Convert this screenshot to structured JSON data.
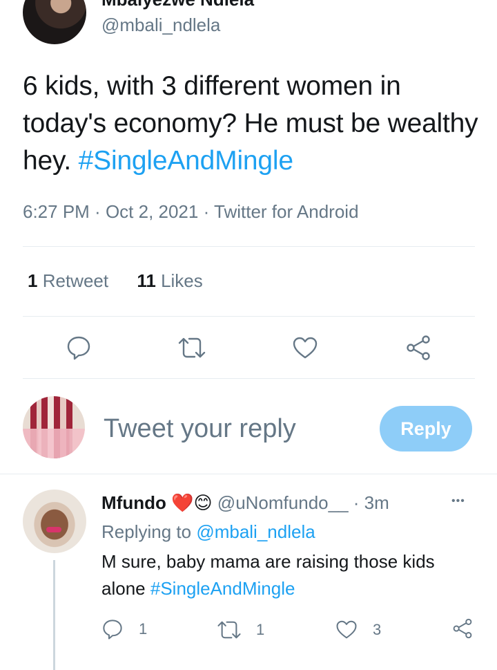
{
  "tweet": {
    "author_name": "Mbalyezwe Ndlela",
    "handle": "@mbali_ndlela",
    "more": "•••",
    "text": "6 kids, with 3 different women in today's economy? He must be wealthy hey.",
    "hashtag": "#SingleAndMingle",
    "timestamp": "6:27 PM",
    "sep1": " · ",
    "date": "Oct 2, 2021",
    "sep2": " · ",
    "source": "Twitter for Android",
    "retweet_count": "1",
    "retweet_label": "Retweet",
    "like_count": "11",
    "like_label": "Likes"
  },
  "actions": {
    "reply_icon": "speech-bubble-icon",
    "retweet_icon": "retweet-icon",
    "like_icon": "heart-icon",
    "share_icon": "share-icon"
  },
  "composer": {
    "placeholder": "Tweet your reply",
    "button": "Reply",
    "button_color": "#8ecdf8"
  },
  "reply": {
    "name": "Mfundo",
    "emoji_heart": "❤️",
    "emoji_smile": "😊",
    "handle": "@uNomfundo__",
    "sep": " · ",
    "time": "3m",
    "more": "•••",
    "replying_prefix": "Replying to",
    "replying_handle": "@mbali_ndlela",
    "text_line1": "M sure, baby mama are raising those kids",
    "text_line2": "alone",
    "hashtag": "#SingleAndMingle",
    "reply_count": "1",
    "retweet_count": "1",
    "like_count": "3"
  },
  "colors": {
    "accent": "#1da1f2",
    "secondary_text": "#657786",
    "divider": "#e6ecf0"
  }
}
